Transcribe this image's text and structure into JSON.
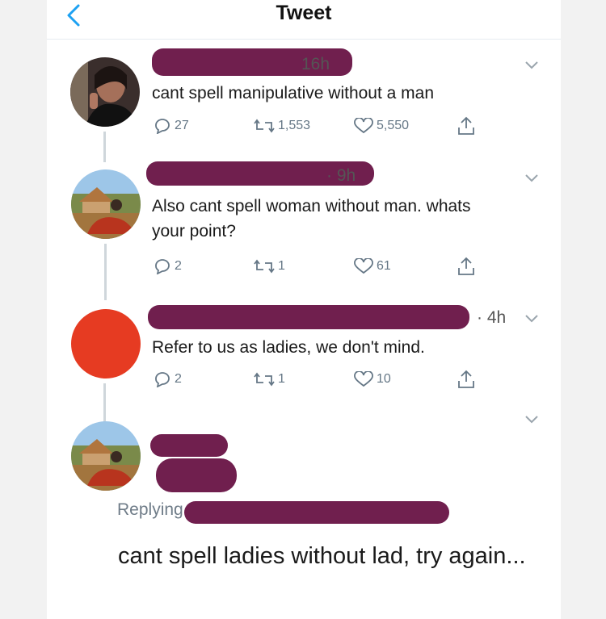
{
  "header": {
    "title": "Tweet"
  },
  "tweets": [
    {
      "time": "16h",
      "text": "cant spell manipulative without a man",
      "replies": "27",
      "retweets": "1,553",
      "likes": "5,550"
    },
    {
      "time": "· 9h",
      "text": "Also cant spell woman without man. whats your point?",
      "replies": "2",
      "retweets": "1",
      "likes": "61"
    },
    {
      "time": "· 4h",
      "text": "Refer to us as ladies, we don't mind.",
      "replies": "2",
      "retweets": "1",
      "likes": "10"
    }
  ],
  "main_tweet": {
    "replying_label": "Replying to",
    "text": "cant spell ladies without lad, try again..."
  },
  "colors": {
    "accent": "#1da1f2",
    "redaction": "#701f4e",
    "avatar_red": "#e63b22"
  }
}
